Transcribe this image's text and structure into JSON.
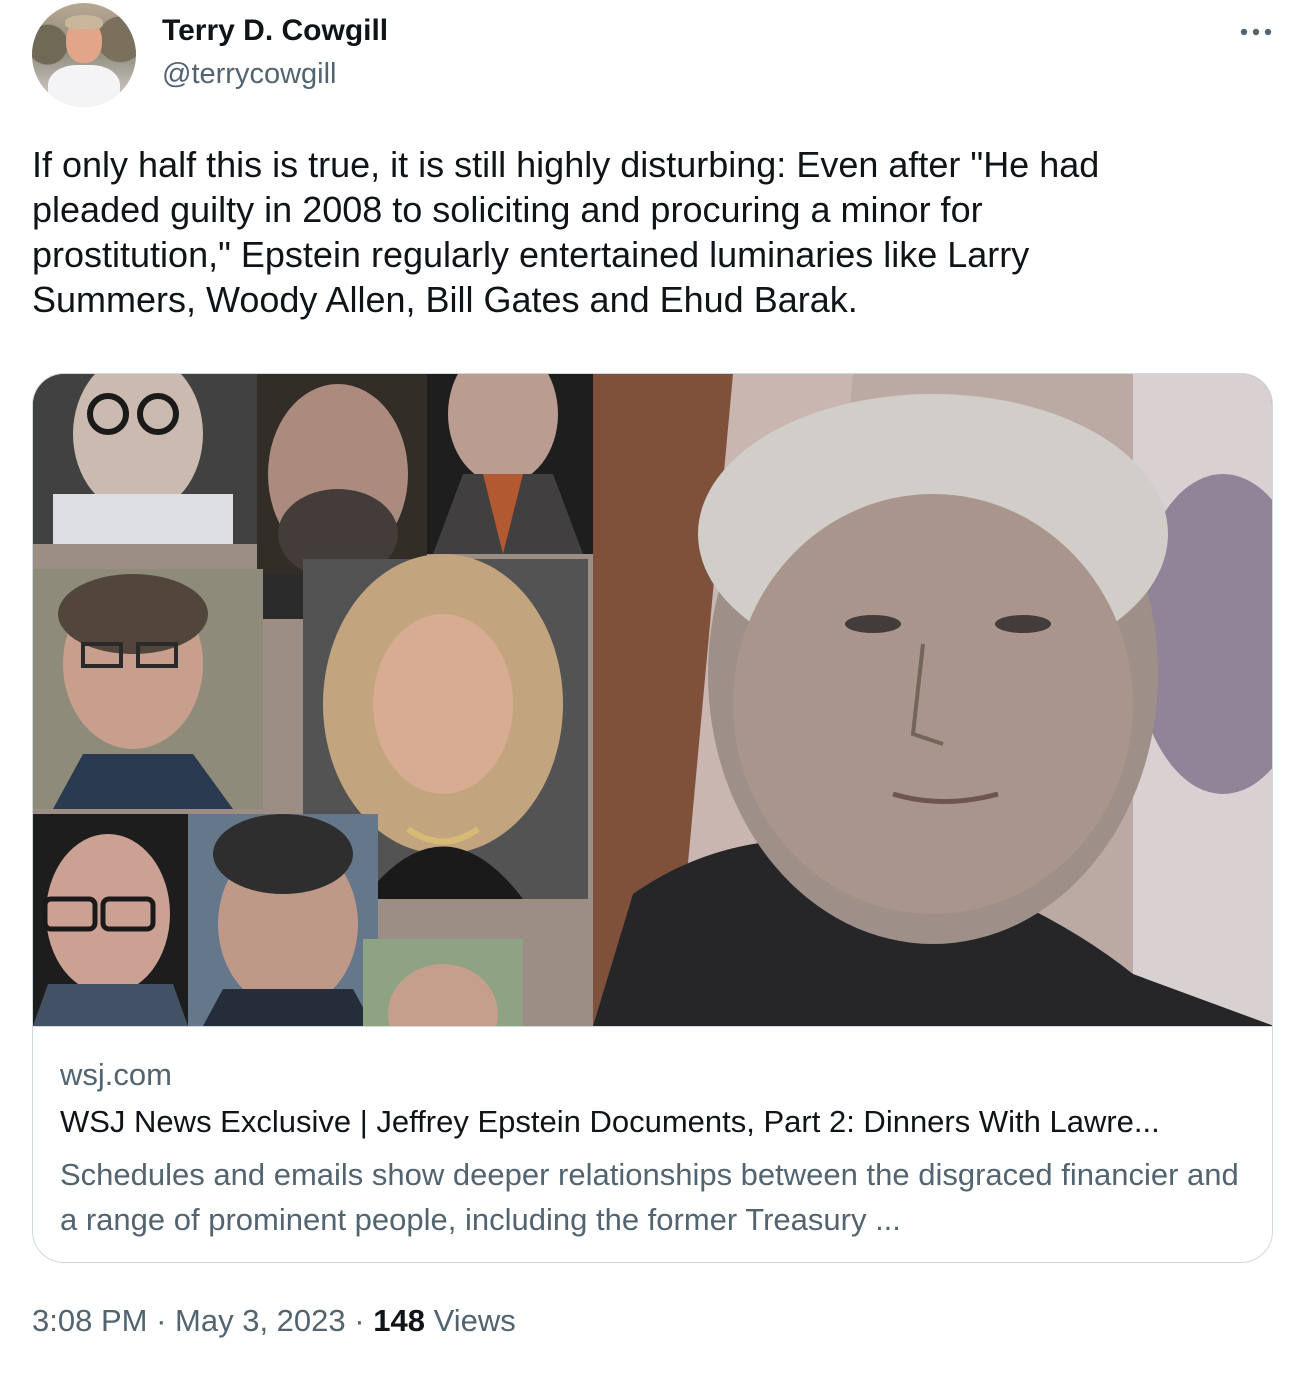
{
  "author": {
    "name": "Terry D. Cowgill",
    "handle": "@terrycowgill"
  },
  "tweet": {
    "text": "If only half this is true, it is still highly disturbing: Even after \"He had\npleaded guilty in 2008 to soliciting and procuring a minor for\nprostitution,\" Epstein regularly entertained luminaries like Larry\nSummers, Woody Allen, Bill Gates and Ehud Barak."
  },
  "card": {
    "domain": "wsj.com",
    "title": "WSJ News Exclusive | Jeffrey Epstein Documents, Part 2: Dinners With Lawre...",
    "description": "Schedules and emails show deeper relationships between the disgraced financier and a range of prominent people, including the former Treasury ..."
  },
  "meta": {
    "time": "3:08 PM",
    "separator": "·",
    "date": "May 3, 2023",
    "views_count": "148",
    "views_label": "Views"
  },
  "icons": {
    "more": "more-horizontal-icon"
  },
  "colors": {
    "text_primary": "#0f1419",
    "text_secondary": "#536471",
    "border": "#cfd9de"
  }
}
